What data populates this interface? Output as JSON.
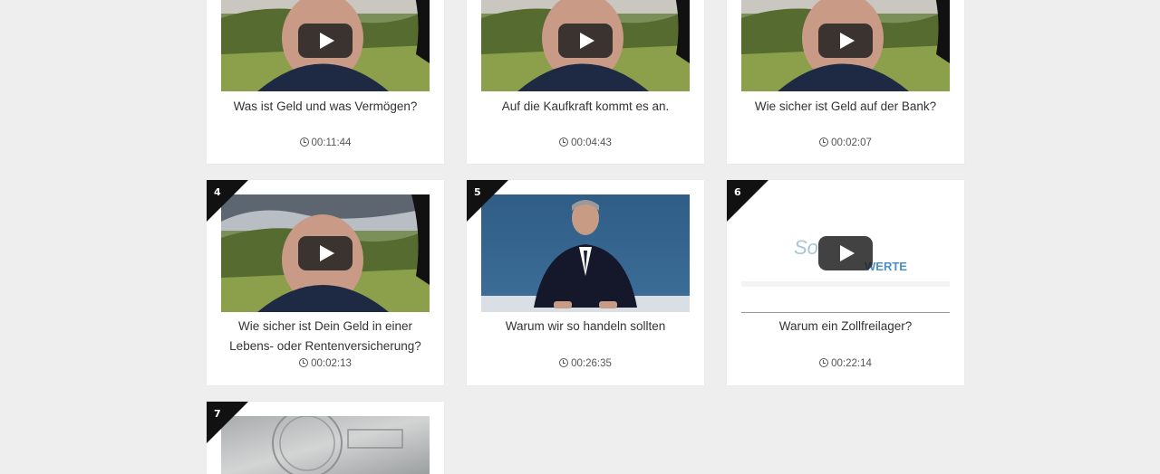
{
  "videos": [
    {
      "number": "",
      "title": "Was ist Geld und was Vermögen?",
      "duration": "00:11:44",
      "thumb": "man-landscape"
    },
    {
      "number": "",
      "title": "Auf die Kaufkraft kommt es an.",
      "duration": "00:04:43",
      "thumb": "man-landscape"
    },
    {
      "number": "",
      "title": "Wie sicher ist Geld auf der Bank?",
      "duration": "00:02:07",
      "thumb": "man-landscape"
    },
    {
      "number": "4",
      "title": "Wie sicher ist Dein Geld in einer Lebens- oder Rentenversicherung?",
      "duration": "00:02:13",
      "thumb": "man-landscape"
    },
    {
      "number": "5",
      "title": "Warum wir so handeln sollten",
      "duration": "00:26:35",
      "thumb": "man-suit"
    },
    {
      "number": "6",
      "title": "Warum ein Zollfreilager?",
      "duration": "00:22:14",
      "thumb": "logo",
      "logo_text_1": "So",
      "logo_text_2": "WERTE"
    },
    {
      "number": "7",
      "title": "",
      "duration": "",
      "thumb": "silver-bar"
    }
  ],
  "icons": {
    "play": "play-icon",
    "duration": "clock-icon"
  },
  "colors": {
    "page_bg": "#eeeeee",
    "card_bg": "#ffffff",
    "badge": "#111111"
  }
}
